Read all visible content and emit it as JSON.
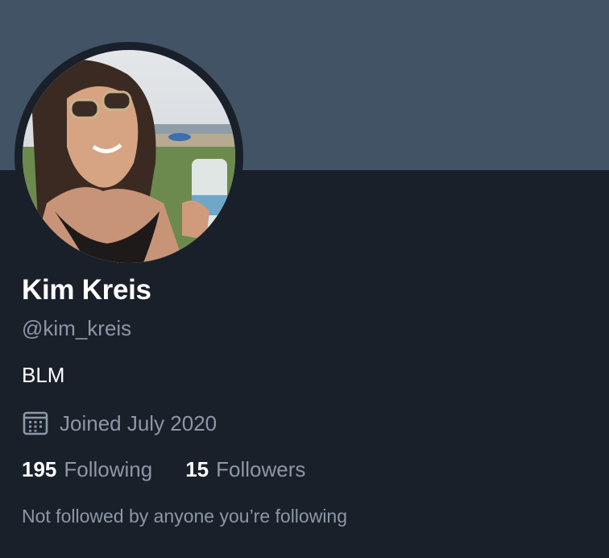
{
  "profile": {
    "display_name": "Kim Kreis",
    "handle": "@kim_kreis",
    "bio": "BLM",
    "joined": "Joined July 2020",
    "avatar_icon": "profile-photo",
    "calendar_icon": "calendar-icon"
  },
  "stats": {
    "following_count": "195",
    "following_label": "Following",
    "followers_count": "15",
    "followers_label": "Followers"
  },
  "followed_by": "Not followed by anyone you’re following",
  "colors": {
    "banner": "#425365",
    "background": "#1a202a",
    "primary_text": "#ffffff",
    "secondary_text": "#8b98a5"
  }
}
